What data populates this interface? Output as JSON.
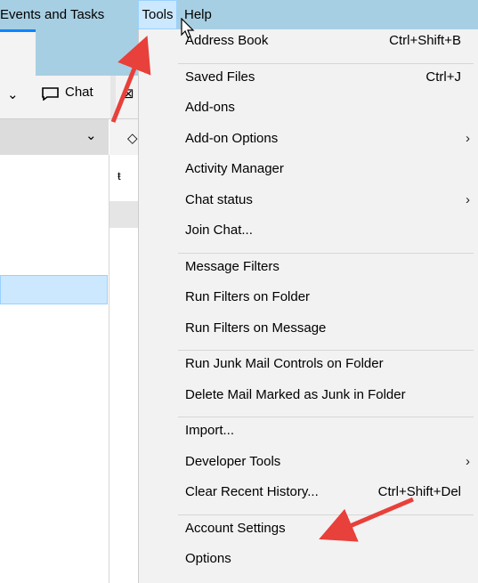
{
  "menubar": {
    "events_and_tasks": "Events and Tasks",
    "tools": "Tools",
    "help": "Help"
  },
  "toolbar": {
    "chat_label": "Chat"
  },
  "background": {
    "column_glyph": "ŧ"
  },
  "tools_menu": {
    "groups": [
      [
        {
          "label": "Address Book",
          "shortcut": "Ctrl+Shift+B"
        }
      ],
      [
        {
          "label": "Saved Files",
          "shortcut": "Ctrl+J"
        },
        {
          "label": "Add-ons"
        },
        {
          "label": "Add-on Options",
          "submenu": true
        },
        {
          "label": "Activity Manager"
        },
        {
          "label": "Chat status",
          "submenu": true
        },
        {
          "label": "Join Chat..."
        }
      ],
      [
        {
          "label": "Message Filters"
        },
        {
          "label": "Run Filters on Folder"
        },
        {
          "label": "Run Filters on Message"
        }
      ],
      [
        {
          "label": "Run Junk Mail Controls on Folder"
        },
        {
          "label": "Delete Mail Marked as Junk in Folder"
        }
      ],
      [
        {
          "label": "Import..."
        },
        {
          "label": "Developer Tools",
          "submenu": true
        },
        {
          "label": "Clear Recent History...",
          "shortcut": "Ctrl+Shift+Del"
        }
      ],
      [
        {
          "label": "Account Settings"
        },
        {
          "label": "Options"
        }
      ]
    ]
  },
  "colors": {
    "menubar_bg": "#a7cfe3",
    "menu_bg": "#f2f2f2",
    "annotation_arrow": "#e8403a"
  }
}
